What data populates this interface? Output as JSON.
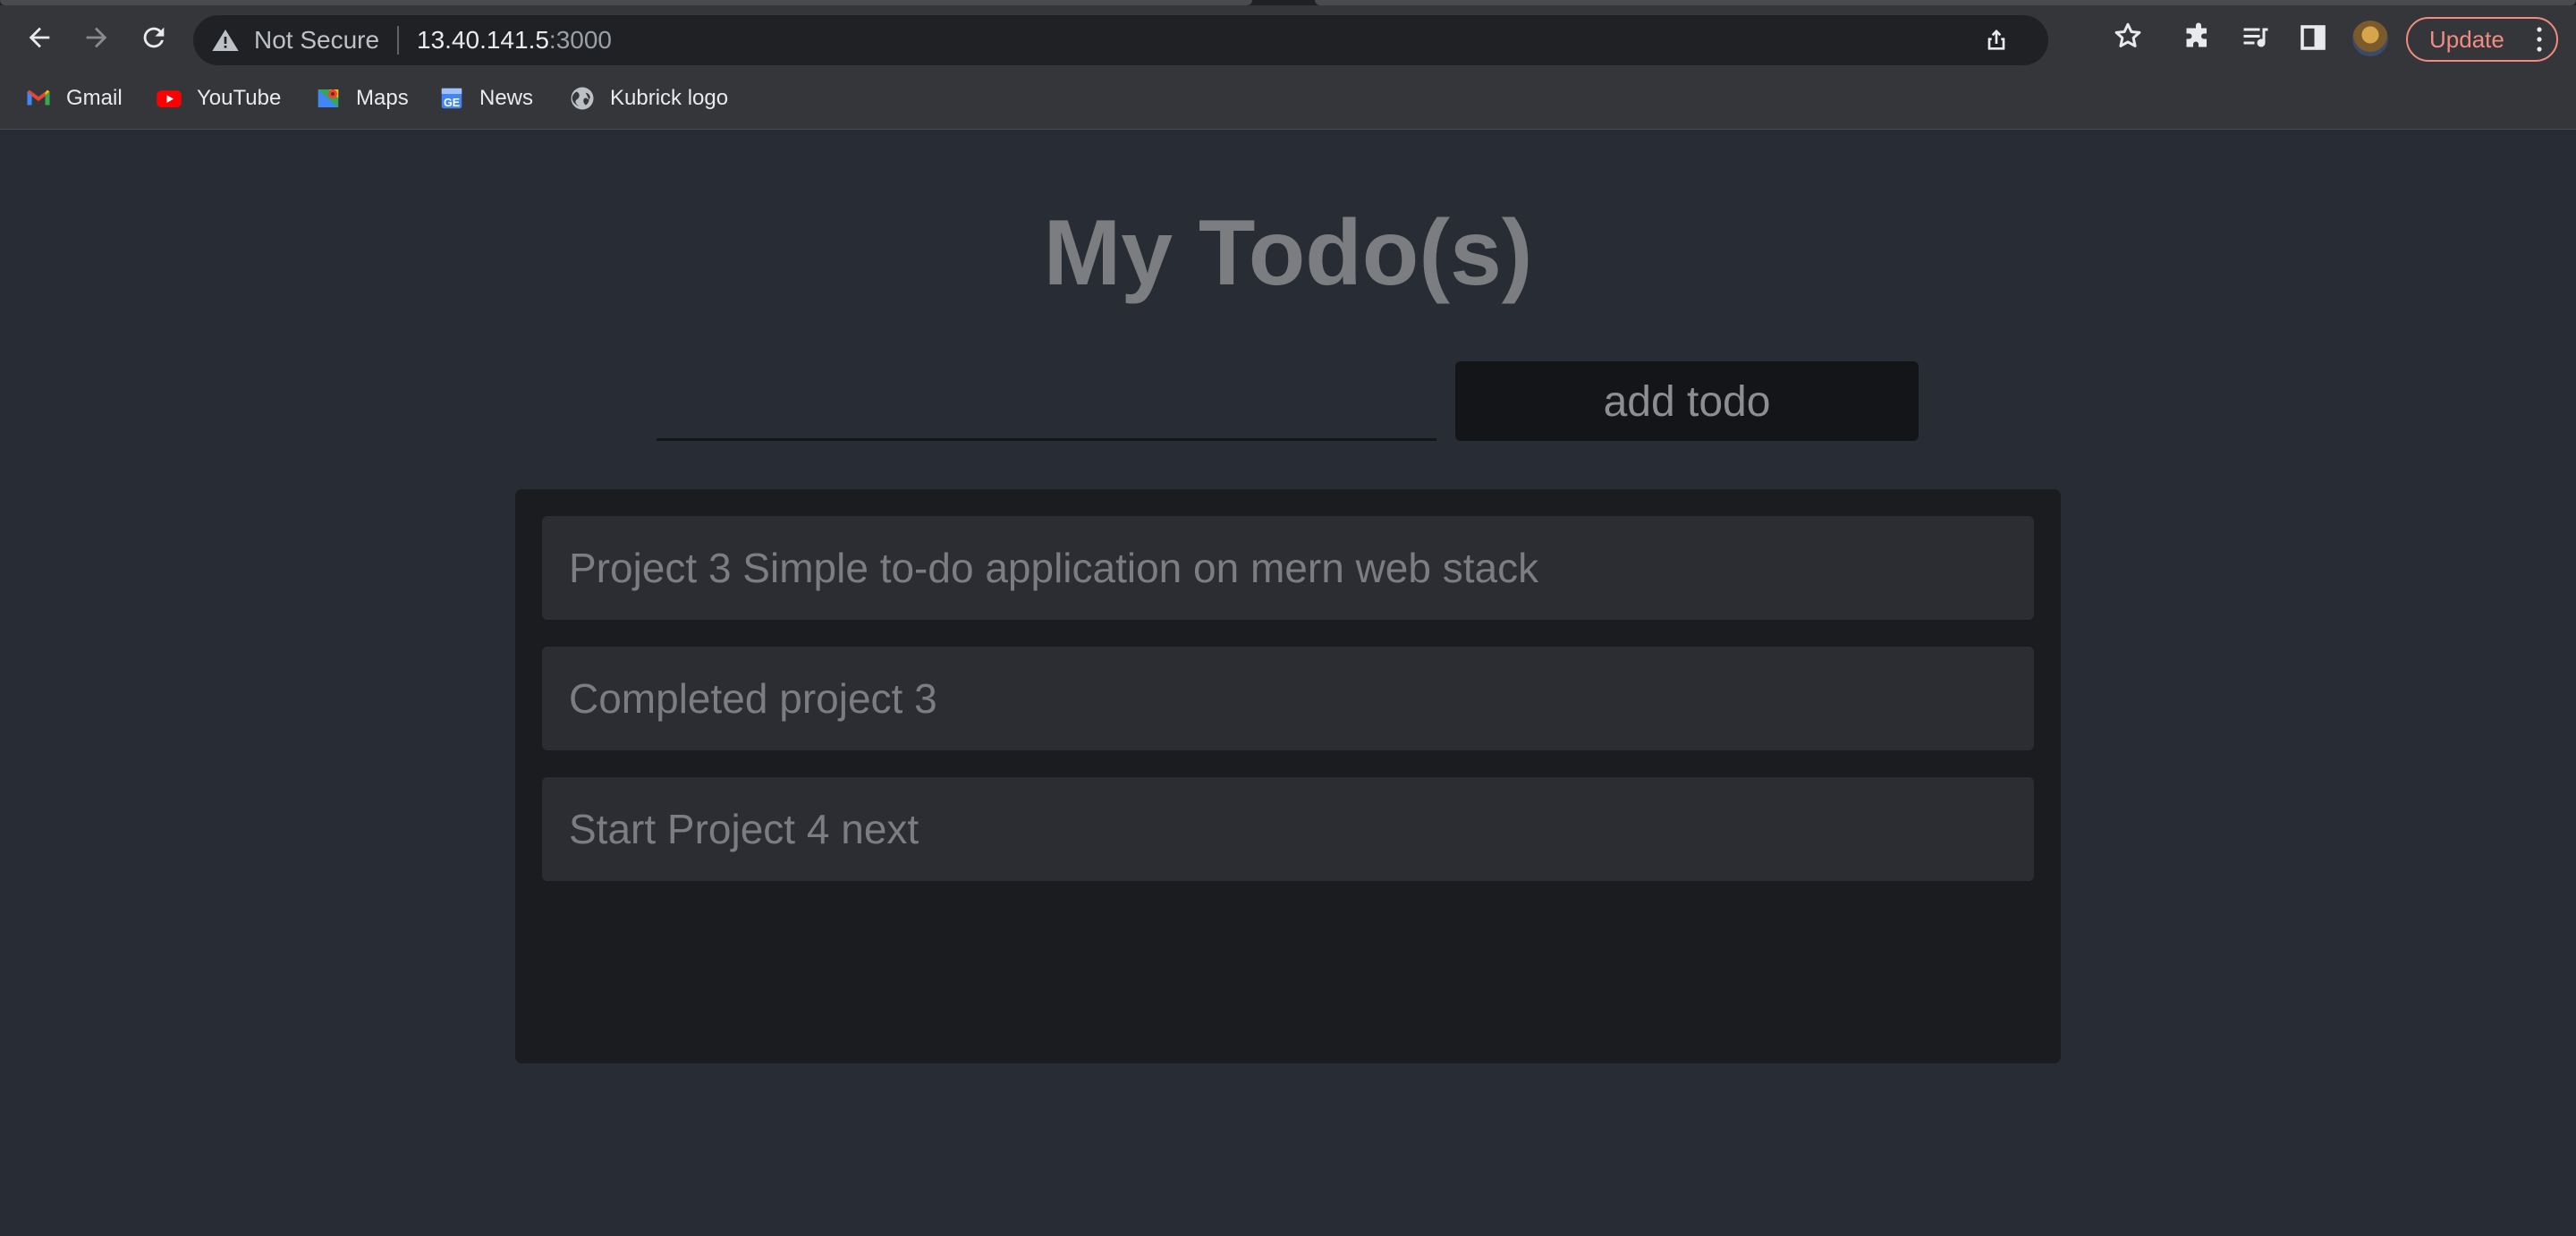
{
  "browser": {
    "omnibox": {
      "security_label": "Not Secure",
      "url_host": "13.40.141.5",
      "url_port": ":3000"
    },
    "update_label": "Update",
    "bookmarks": [
      {
        "label": "Gmail",
        "icon": "gmail-icon"
      },
      {
        "label": "YouTube",
        "icon": "youtube-icon"
      },
      {
        "label": "Maps",
        "icon": "maps-icon"
      },
      {
        "label": "News",
        "icon": "news-icon"
      },
      {
        "label": "Kubrick logo",
        "icon": "globe-icon"
      }
    ],
    "toolbar_icons": [
      "back-icon",
      "forward-icon",
      "reload-icon",
      "share-icon",
      "star-icon",
      "extensions-icon",
      "media-icon",
      "side-panel-icon",
      "avatar",
      "kebab-menu-icon"
    ]
  },
  "app": {
    "title": "My Todo(s)",
    "input": {
      "value": "",
      "placeholder": ""
    },
    "add_button_label": "add todo",
    "todos": [
      {
        "text": "Project 3 Simple to-do application on mern web stack"
      },
      {
        "text": "Completed project 3"
      },
      {
        "text": "Start Project 4 next"
      }
    ]
  },
  "colors": {
    "page_background": "#282c34",
    "list_background": "#1b1c20",
    "item_background": "#2b2d33",
    "text_muted": "#7c7d80",
    "update_accent": "#f28b82"
  }
}
